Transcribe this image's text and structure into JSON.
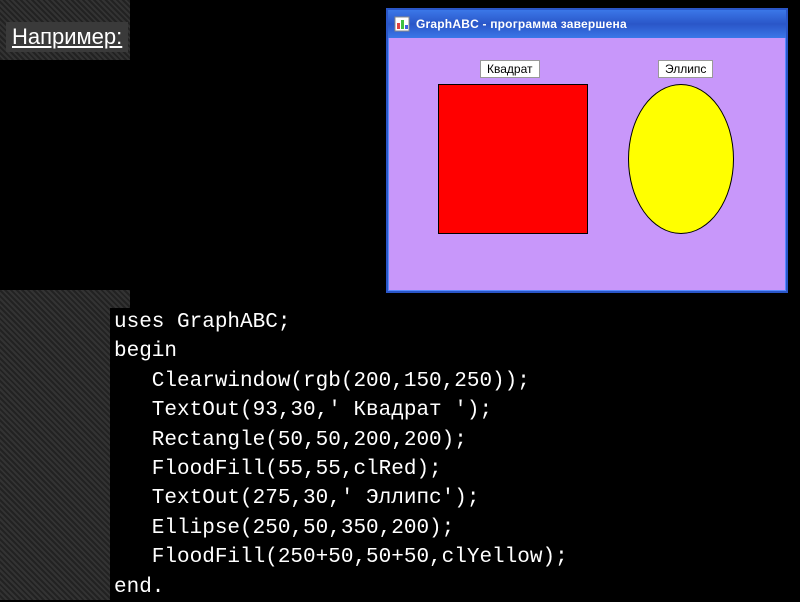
{
  "example_label": "Например:",
  "code_lines": [
    "uses GraphABC;",
    "begin",
    "   Clearwindow(rgb(200,150,250));",
    "   TextOut(93,30,' Квадрат ');",
    "   Rectangle(50,50,200,200);",
    "   FloodFill(55,55,clRed);",
    "   TextOut(275,30,' Эллипс');",
    "   Ellipse(250,50,350,200);",
    "   FloodFill(250+50,50+50,clYellow);",
    "end."
  ],
  "window": {
    "title": "GraphABC - программа завершена",
    "canvas_bg": "#c897fa",
    "labels": {
      "square": "Квадрат",
      "ellipse": "Эллипс"
    },
    "shapes": {
      "square_fill": "#ff0000",
      "ellipse_fill": "#ffff00"
    }
  }
}
